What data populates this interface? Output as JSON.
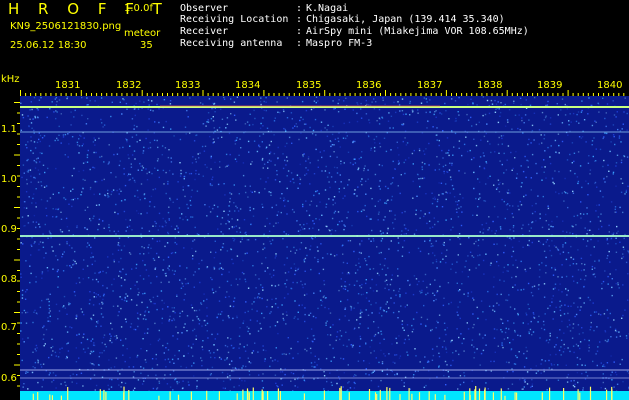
{
  "header": {
    "app_title": "H R O F F T",
    "version": "1.0.0f",
    "filename": "KN9_2506121830.png",
    "meteo_label": "meteor",
    "timestamp": "25.06.12 18:30",
    "meteor_count": "35"
  },
  "info": [
    {
      "label": "Observer",
      "value": "K.Nagai"
    },
    {
      "label": "Receiving Location",
      "value": "Chigasaki, Japan (139.414 35.340)"
    },
    {
      "label": "Receiver",
      "value": "AirSpy mini (Miakejima VOR 108.65MHz)"
    },
    {
      "label": "Receiving antenna",
      "value": "Maspro FM-3"
    }
  ],
  "info_separator": ":",
  "axis": {
    "y_unit": "kHz",
    "y_ticks": [
      "1.1",
      "1.0",
      "0.9",
      "0.8",
      "0.7",
      "0.6"
    ],
    "x_ticks": [
      "1831",
      "1832",
      "1833",
      "1834",
      "1835",
      "1836",
      "1837",
      "1838",
      "1839",
      "1840"
    ]
  },
  "colors": {
    "background": "#000000",
    "spectro_bg": "#0a1a8c",
    "label": "#ffff00",
    "noise_floor": "#00e5ff"
  }
}
